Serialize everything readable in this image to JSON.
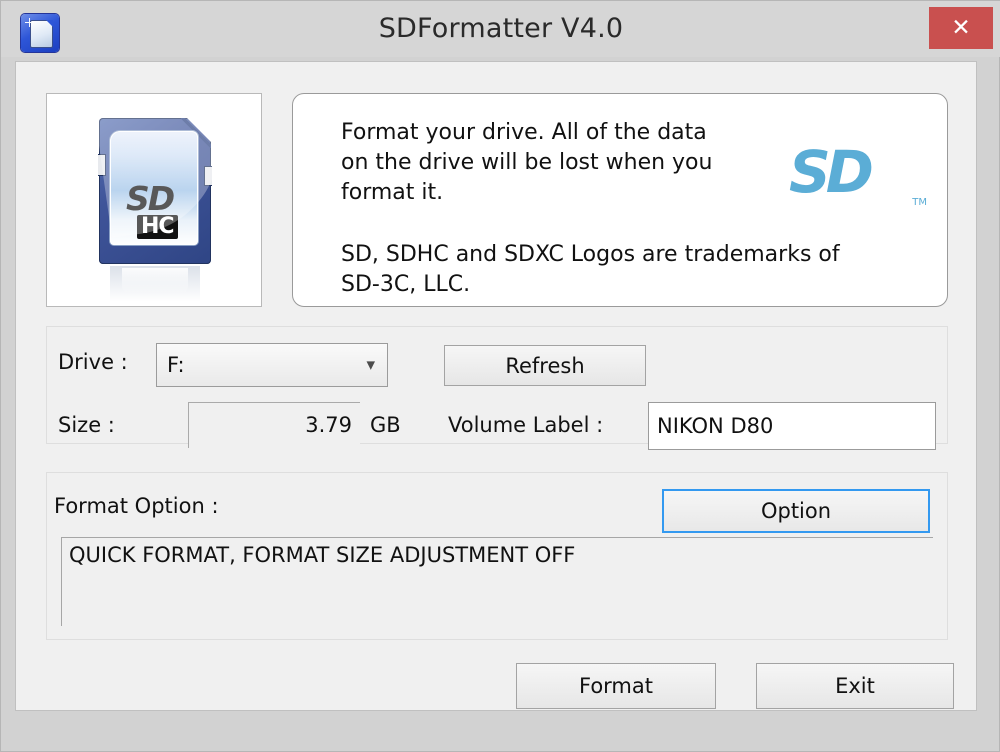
{
  "window": {
    "title": "SDFormatter V4.0",
    "close_label": "✕",
    "icon": "sd-card-app-icon"
  },
  "info_panel": {
    "paragraph_1": "Format your drive. All of the data\non the drive will be lost when you\nformat it.",
    "paragraph_2": "SD, SDHC and SDXC Logos are trademarks of\nSD-3C, LLC.",
    "brand_logo_text": "SD",
    "brand_trademark": "TM"
  },
  "card_image": {
    "logo_text": "SD",
    "capacity_class": "HC"
  },
  "drive_section": {
    "drive_label": "Drive :",
    "drive_value": "F:",
    "drive_chevron": "❯",
    "refresh_label": "Refresh",
    "size_label": "Size  :",
    "size_value": "3.79",
    "size_unit": "GB",
    "volume_label": "Volume Label :",
    "volume_value": "NIKON D80"
  },
  "format_section": {
    "title": "Format Option :",
    "option_button": "Option",
    "status_text": "QUICK FORMAT, FORMAT SIZE ADJUSTMENT OFF"
  },
  "footer": {
    "format_label": "Format",
    "exit_label": "Exit"
  },
  "colors": {
    "close_button": "#c9504f",
    "focus_border": "#3399f0",
    "sd_brand_blue": "#5badd6",
    "titlebar": "#d6d6d6",
    "client_bg": "#f0f0f0"
  }
}
